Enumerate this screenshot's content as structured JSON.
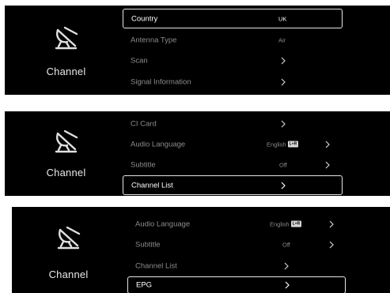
{
  "panels": [
    {
      "section_label": "Channel",
      "items": [
        {
          "label": "Country",
          "value": "UK",
          "selected": true
        },
        {
          "label": "Antenna Type",
          "value": "Air"
        },
        {
          "label": "Scan"
        },
        {
          "label": "Signal Information"
        }
      ]
    },
    {
      "section_label": "Channel",
      "items": [
        {
          "label": "CI Card"
        },
        {
          "label": "Audio Language",
          "value": "English",
          "badge": "L+R"
        },
        {
          "label": "Subtitle",
          "value": "Off"
        },
        {
          "label": "Channel List",
          "selected": true
        }
      ]
    },
    {
      "section_label": "Channel",
      "items": [
        {
          "label": "Audio Language",
          "value": "English",
          "badge": "L+R"
        },
        {
          "label": "Subtitle",
          "value": "Off"
        },
        {
          "label": "Channel List"
        },
        {
          "label": "EPG",
          "selected": true
        }
      ]
    }
  ],
  "icons": {
    "section": "satellite-dish-icon",
    "submenu": "chevron-right-icon"
  },
  "colors": {
    "background": "#000000",
    "text_dim": "#8c8c8c",
    "text_bright": "#ffffff",
    "highlight_border": "#e6e6e6"
  }
}
